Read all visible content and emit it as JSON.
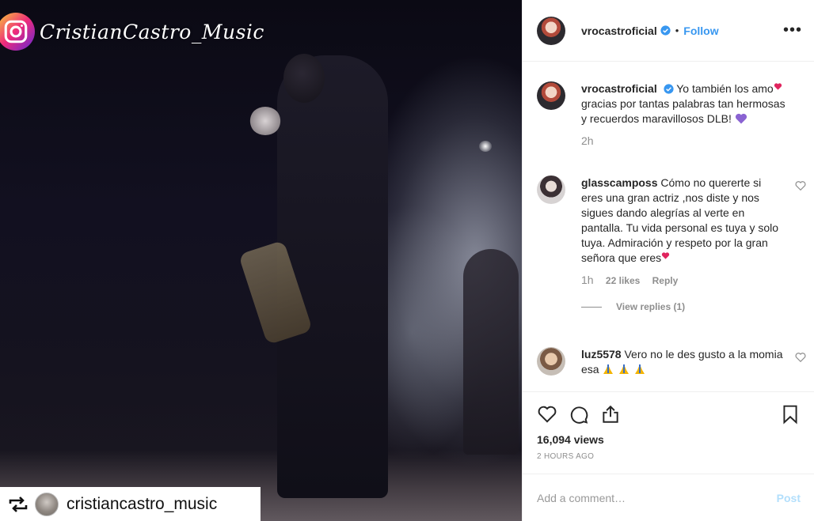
{
  "media": {
    "watermark_text": "CristianCastro_Music",
    "repost_username": "cristiancastro_music"
  },
  "header": {
    "username": "vrocastroficial",
    "separator": "•",
    "follow_label": "Follow",
    "more_label": "•••"
  },
  "caption": {
    "username": "vrocastroficial",
    "text": "Yo también los amo",
    "text2": "gracias por tantas palabras tan hermosas y recuerdos maravillosos DLB!",
    "age": "2h"
  },
  "comments": [
    {
      "username": "glasscamposs",
      "text": "Cómo no quererte si eres una gran actriz ,nos diste y nos sigues dando alegrías al verte en pantalla. Tu vida personal es tuya y solo tuya. Admiración y respeto por la gran señora que eres",
      "age": "1h",
      "likes": "22 likes",
      "reply_label": "Reply",
      "view_replies": "View replies (1)"
    },
    {
      "username": "luz5578",
      "text": "Vero no le des gusto a la momia esa"
    }
  ],
  "actions": {
    "views": "16,094 views",
    "time": "2 HOURS AGO"
  },
  "add_comment": {
    "placeholder": "Add a comment…",
    "post_label": "Post"
  },
  "colors": {
    "accent": "#3897f0",
    "post_disabled": "#b2dffc",
    "muted": "#8e8e8e"
  }
}
